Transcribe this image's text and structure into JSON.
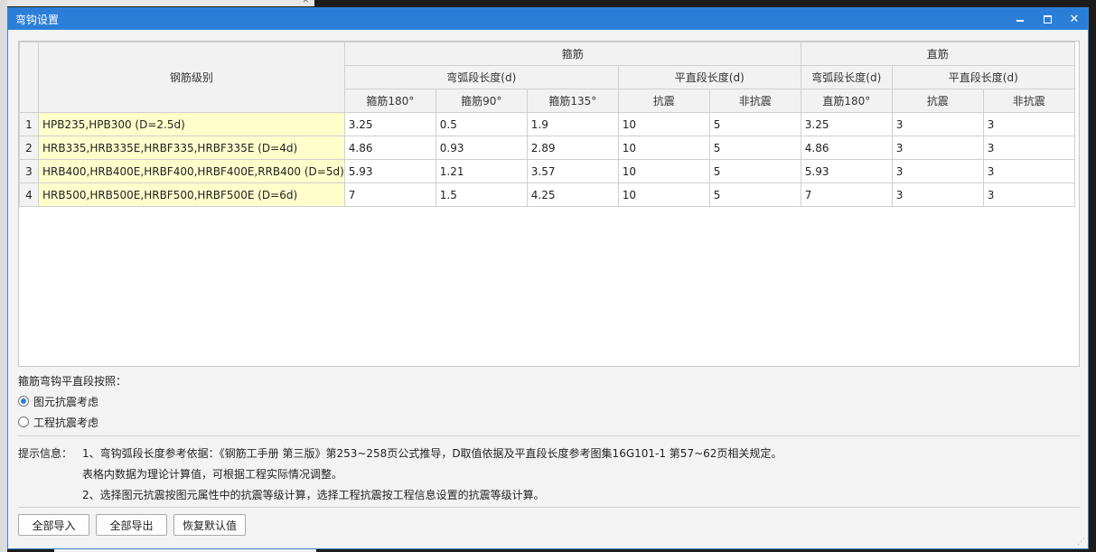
{
  "window": {
    "title": "弯钩设置",
    "minimize_label": "",
    "close_label": "✕"
  },
  "table": {
    "header": {
      "grade": "钢筋级别",
      "stirrup": "箍筋",
      "straight": "直筋",
      "arc_length": "弯弧段长度(d)",
      "flat_length": "平直段长度(d)",
      "straight_arc_length": "弯弧段长度(d)",
      "straight_flat_length": "平直段长度(d)",
      "stirrup_180": "箍筋180°",
      "stirrup_90": "箍筋90°",
      "stirrup_135": "箍筋135°",
      "seismic": "抗震",
      "non_seismic": "非抗震",
      "straight_180": "直筋180°",
      "straight_seismic": "抗震",
      "straight_non_seismic": "非抗震"
    },
    "rows": [
      {
        "num": "1",
        "grade": "HPB235,HPB300 (D=2.5d)",
        "c180": "3.25",
        "c90": "0.5",
        "c135": "1.9",
        "seismic": "10",
        "nonseismic": "5",
        "s180": "3.25",
        "sseismic": "3",
        "snonseismic": "3"
      },
      {
        "num": "2",
        "grade": "HRB335,HRB335E,HRBF335,HRBF335E (D=4d)",
        "c180": "4.86",
        "c90": "0.93",
        "c135": "2.89",
        "seismic": "10",
        "nonseismic": "5",
        "s180": "4.86",
        "sseismic": "3",
        "snonseismic": "3"
      },
      {
        "num": "3",
        "grade": "HRB400,HRB400E,HRBF400,HRBF400E,RRB400 (D=5d)",
        "c180": "5.93",
        "c90": "1.21",
        "c135": "3.57",
        "seismic": "10",
        "nonseismic": "5",
        "s180": "5.93",
        "sseismic": "3",
        "snonseismic": "3"
      },
      {
        "num": "4",
        "grade": "HRB500,HRB500E,HRBF500,HRBF500E (D=6d)",
        "c180": "7",
        "c90": "1.5",
        "c135": "4.25",
        "seismic": "10",
        "nonseismic": "5",
        "s180": "7",
        "sseismic": "3",
        "snonseismic": "3"
      }
    ]
  },
  "option": {
    "label": "箍筋弯钩平直段按照：",
    "choices": [
      {
        "label": "图元抗震考虑",
        "checked": true
      },
      {
        "label": "工程抗震考虑",
        "checked": false
      }
    ]
  },
  "hints": {
    "label": "提示信息：",
    "line1": "1、弯钩弧段长度参考依据：《钢筋工手册 第三版》第253~258页公式推导，D取值依据及平直段长度参考图集16G101-1 第57~62页相关规定。",
    "line2": "表格内数据为理论计算值，可根据工程实际情况调整。",
    "line3": "2、选择图元抗震按图元属性中的抗震等级计算，选择工程抗震按工程信息设置的抗震等级计算。"
  },
  "buttons": {
    "import_all": "全部导入",
    "export_all": "全部导出",
    "restore_default": "恢复默认值"
  },
  "colors": {
    "titlebar": "#2b7ed8",
    "grade_cell": "#ffffcc"
  }
}
